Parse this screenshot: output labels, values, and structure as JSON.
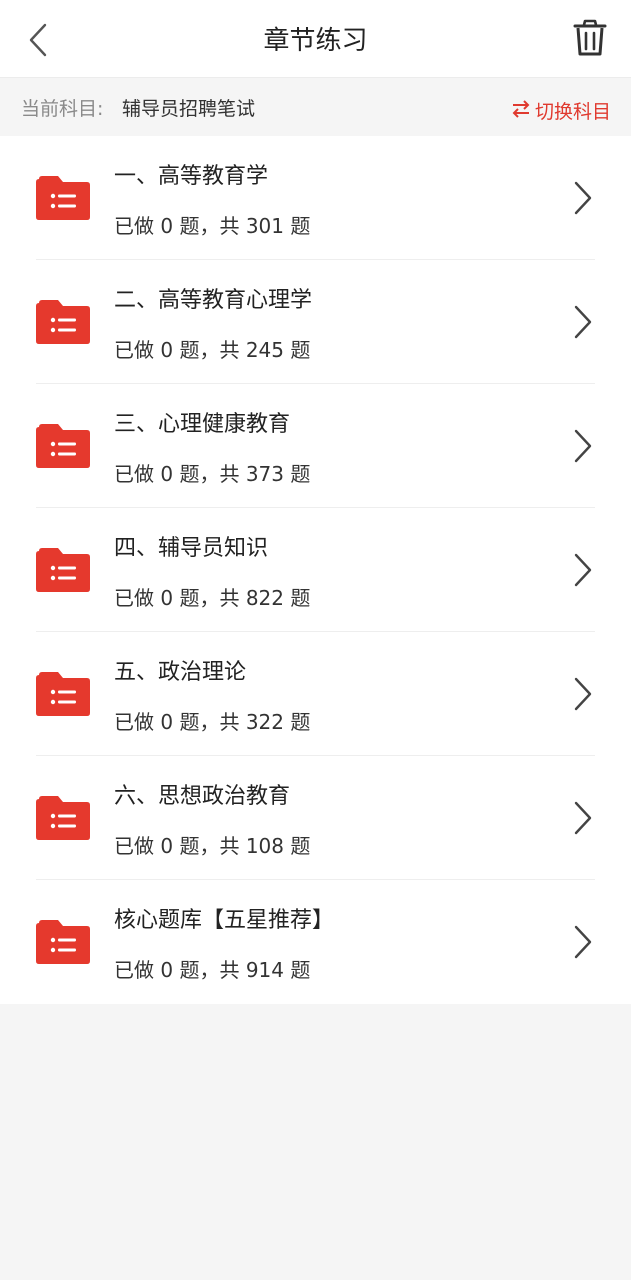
{
  "header": {
    "title": "章节练习"
  },
  "subject": {
    "label": "当前科目:",
    "value": "辅导员招聘笔试",
    "switch_label": "切换科目"
  },
  "chapters": [
    {
      "title": "一、高等教育学",
      "done": "0",
      "total": "301"
    },
    {
      "title": "二、高等教育心理学",
      "done": "0",
      "total": "245"
    },
    {
      "title": "三、心理健康教育",
      "done": "0",
      "total": "373"
    },
    {
      "title": "四、辅导员知识",
      "done": "0",
      "total": "822"
    },
    {
      "title": "五、政治理论",
      "done": "0",
      "total": "322"
    },
    {
      "title": "六、思想政治教育",
      "done": "0",
      "total": "108"
    },
    {
      "title": "核心题库【五星推荐】",
      "done": "0",
      "total": "914"
    }
  ],
  "stat_template": {
    "done_prefix": "已做 ",
    "done_suffix": " 题，共 ",
    "total_suffix": " 题"
  },
  "colors": {
    "accent": "#e03a2f",
    "folder": "#e5392d"
  },
  "icons": {
    "back": "chevron-left-icon",
    "trash": "trash-icon",
    "switch": "swap-arrows-icon",
    "folder": "list-folder-icon",
    "chevron": "chevron-right-icon"
  }
}
